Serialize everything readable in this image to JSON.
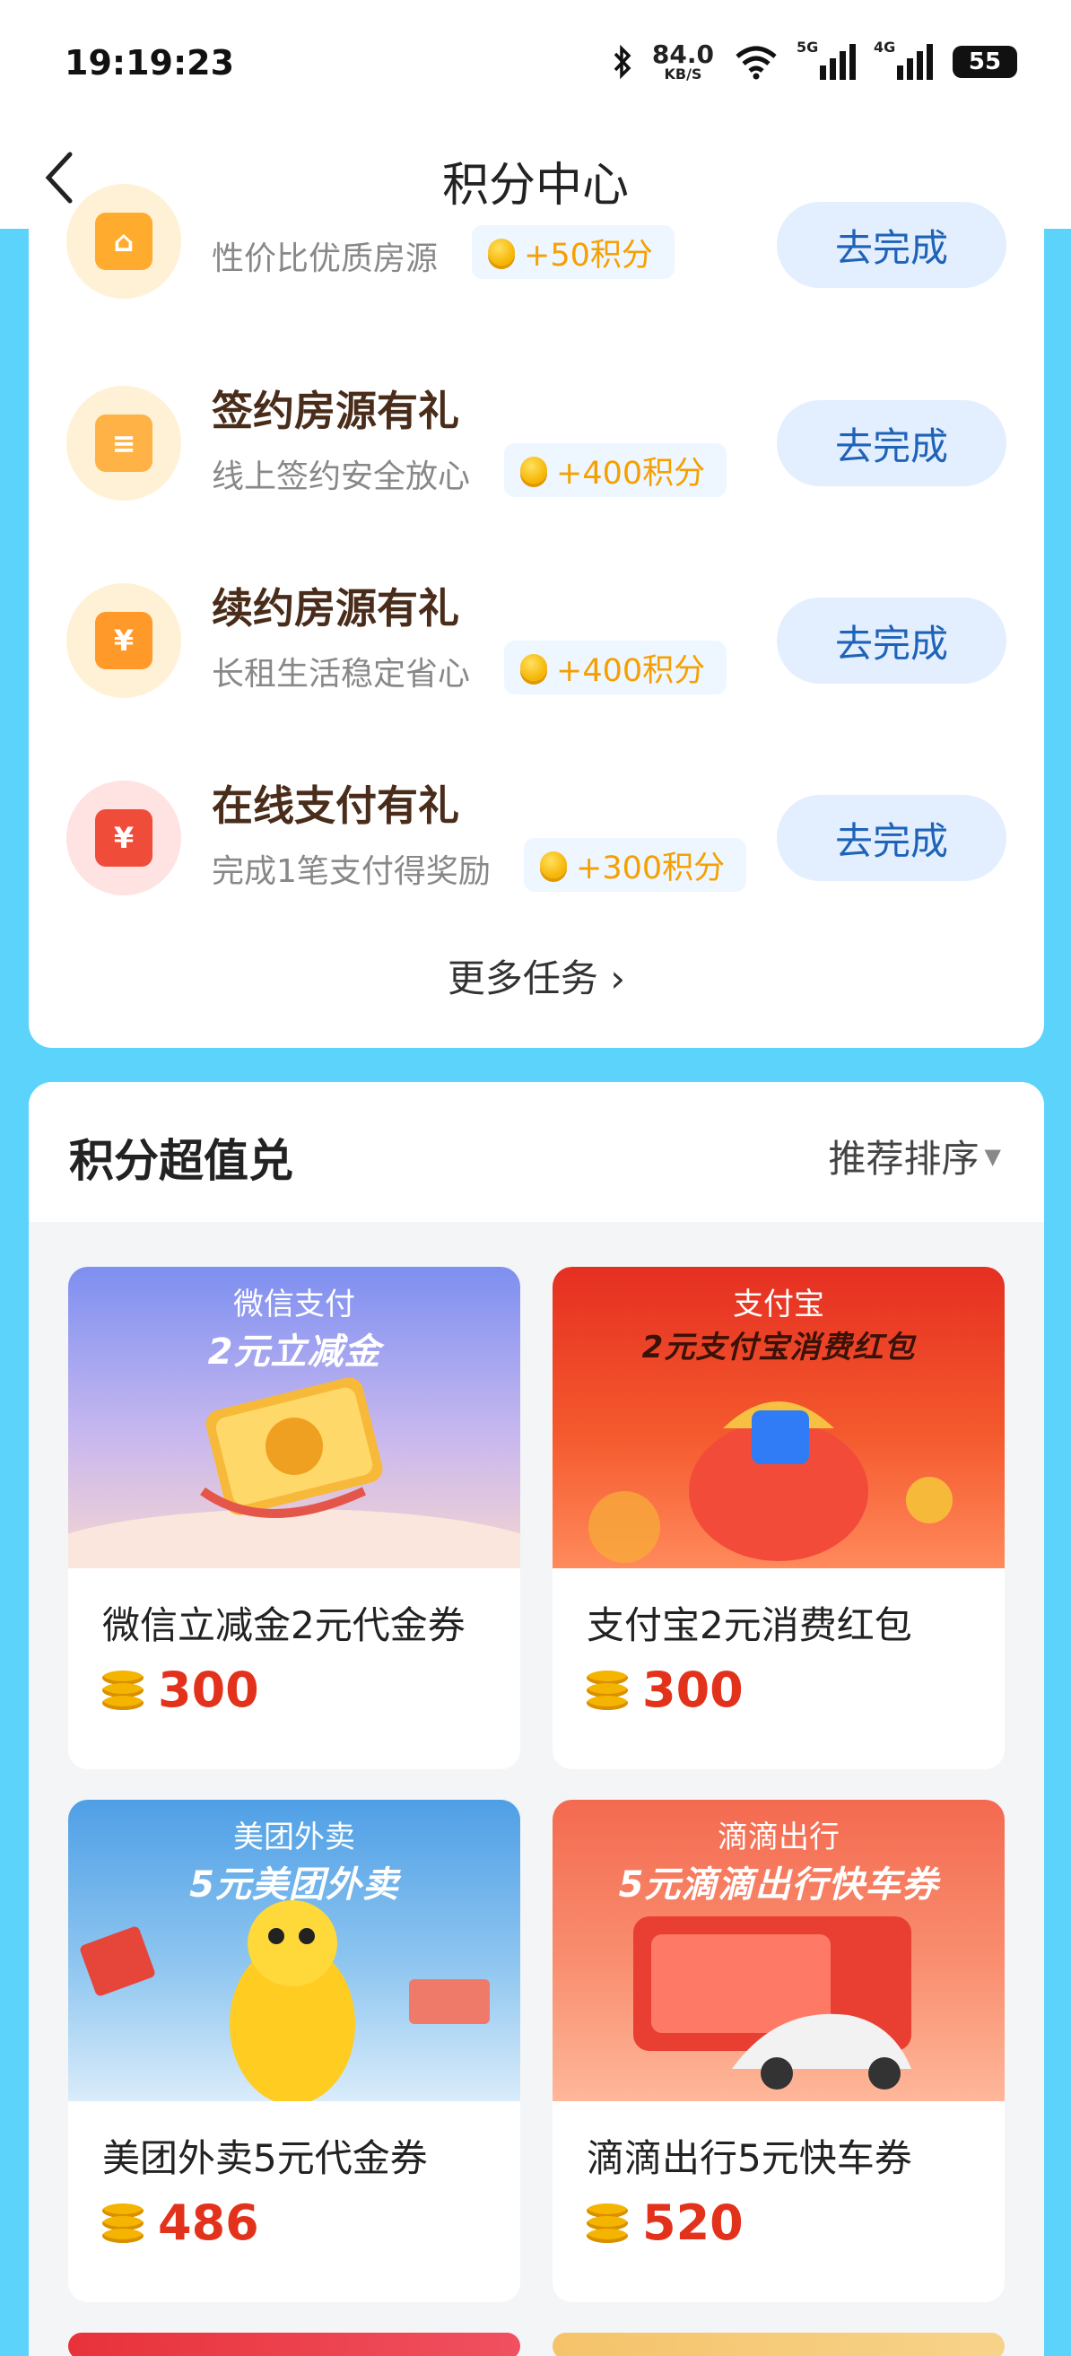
{
  "status_bar": {
    "time": "19:19:23",
    "net_speed_value": "84.0",
    "net_speed_unit": "KB/S",
    "sim1_tag": "5G",
    "sim2_tag": "4G",
    "battery": "55"
  },
  "header": {
    "title": "积分中心"
  },
  "tasks": [
    {
      "title": "",
      "subtitle": "性价比优质房源",
      "points": "+50积分",
      "action": "去完成",
      "icon": "house-key-icon"
    },
    {
      "title": "签约房源有礼",
      "subtitle": "线上签约安全放心",
      "points": "+400积分",
      "action": "去完成",
      "icon": "contract-icon"
    },
    {
      "title": "续约房源有礼",
      "subtitle": "长租生活稳定省心",
      "points": "+400积分",
      "action": "去完成",
      "icon": "yuan-document-icon"
    },
    {
      "title": "在线支付有礼",
      "subtitle": "完成1笔支付得奖励",
      "points": "+300积分",
      "action": "去完成",
      "icon": "wallet-icon"
    }
  ],
  "more_tasks": "更多任务 ›",
  "exchange": {
    "title": "积分超值兑",
    "sort_label": "推荐排序",
    "products": [
      {
        "brand": "微信支付",
        "slogan": "2元立减金",
        "name": "微信立减金2元代金券",
        "price": "300",
        "banner_color": "#8a9cf0"
      },
      {
        "brand": "支付宝",
        "slogan": "2元支付宝消费红包",
        "name": "支付宝2元消费红包",
        "price": "300",
        "banner_color": "#e8402a"
      },
      {
        "brand": "美团外卖",
        "slogan": "5元美团外卖",
        "name": "美团外卖5元代金券",
        "price": "486",
        "banner_color": "#5aa6e6"
      },
      {
        "brand": "滴滴出行",
        "slogan": "5元滴滴出行快车券",
        "name": "滴滴出行5元快车券",
        "price": "520",
        "banner_color": "#f5765a"
      }
    ]
  }
}
